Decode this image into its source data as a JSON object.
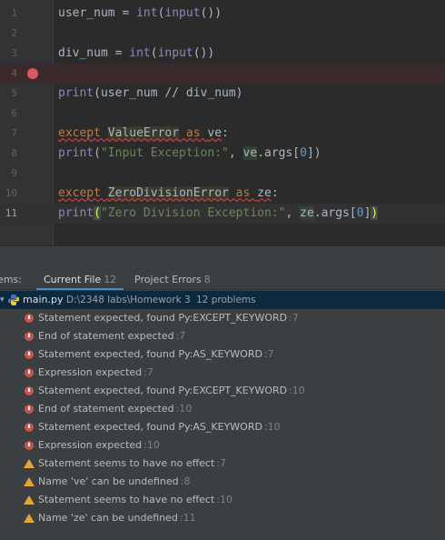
{
  "editor": {
    "line_numbers": [
      "1",
      "2",
      "3",
      "4",
      "5",
      "6",
      "7",
      "8",
      "9",
      "10",
      "11"
    ],
    "lines": {
      "l1": {
        "a": "user_num = ",
        "b": "int",
        "c": "(",
        "d": "input",
        "e": "())"
      },
      "l3": {
        "a": "div_num = ",
        "b": "int",
        "c": "(",
        "d": "input",
        "e": "())"
      },
      "l5": {
        "a": "print",
        "b": "(user_num // div_num)"
      },
      "l7": {
        "a": "except ",
        "b": "ValueError",
        "c": " as ",
        "d": "ve",
        "e": ":"
      },
      "l8": {
        "a": "print",
        "b": "(",
        "c": "\"Input Exception:\"",
        "d": ", ",
        "e": "ve",
        "f": ".args[",
        "g": "0",
        "h": "])"
      },
      "l10": {
        "a": "except ",
        "b": "ZeroDivisionError",
        "c": " as ",
        "d": "ze",
        "e": ":"
      },
      "l11": {
        "a": "print",
        "b": "(",
        "c": "\"Zero Division Exception:\"",
        "d": ", ",
        "e": "ze",
        "f": ".args[",
        "g": "0",
        "h": "]",
        "i": ")"
      }
    },
    "breakpoint_line": 4,
    "current_line": 11
  },
  "problems": {
    "title_fragment": "lems:",
    "tabs": [
      {
        "label": "Current File",
        "count": "12"
      },
      {
        "label": "Project Errors",
        "count": "8"
      }
    ],
    "file": {
      "name": "main.py",
      "path": "D:\\2348 labs\\Homework 3",
      "summary": "12 problems"
    },
    "items": [
      {
        "severity": "error",
        "message": "Statement expected, found Py:EXCEPT_KEYWORD",
        "loc": ":7"
      },
      {
        "severity": "error",
        "message": "End of statement expected",
        "loc": ":7"
      },
      {
        "severity": "error",
        "message": "Statement expected, found Py:AS_KEYWORD",
        "loc": ":7"
      },
      {
        "severity": "error",
        "message": "Expression expected",
        "loc": ":7"
      },
      {
        "severity": "error",
        "message": "Statement expected, found Py:EXCEPT_KEYWORD",
        "loc": ":10"
      },
      {
        "severity": "error",
        "message": "End of statement expected",
        "loc": ":10"
      },
      {
        "severity": "error",
        "message": "Statement expected, found Py:AS_KEYWORD",
        "loc": ":10"
      },
      {
        "severity": "error",
        "message": "Expression expected",
        "loc": ":10"
      },
      {
        "severity": "warning",
        "message": "Statement seems to have no effect",
        "loc": ":7"
      },
      {
        "severity": "warning",
        "message": "Name 've' can be undefined",
        "loc": ":8"
      },
      {
        "severity": "warning",
        "message": "Statement seems to have no effect",
        "loc": ":10"
      },
      {
        "severity": "warning",
        "message": "Name 'ze' can be undefined",
        "loc": ":11"
      }
    ]
  },
  "colors": {
    "error": "#c75450",
    "warning": "#e2a53a",
    "breakpoint": "#db5860",
    "selection": "#0d293e",
    "active_tab": "#4a88c7"
  },
  "icons": {
    "breakpoint": "breakpoint-icon",
    "file": "python-file-icon",
    "expand": "chevron-down-icon",
    "error": "error-icon",
    "warning": "warning-icon"
  }
}
